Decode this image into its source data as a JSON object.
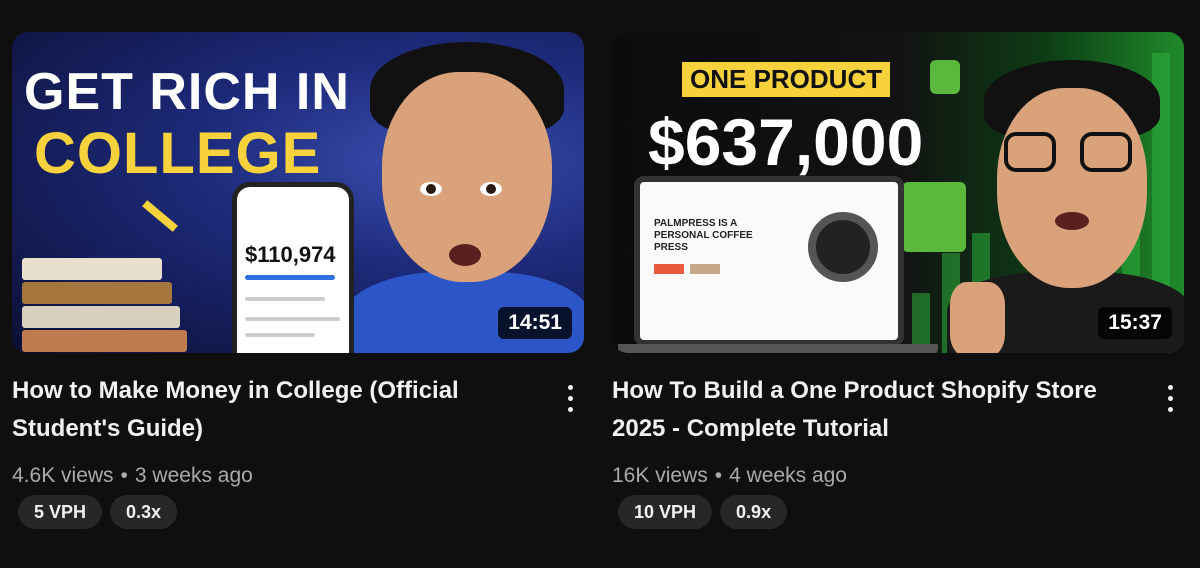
{
  "videos": [
    {
      "duration": "14:51",
      "title": "How to Make Money in College (Official Student's Guide)",
      "views": "4.6K views",
      "age": "3 weeks ago",
      "badges": [
        "5 VPH",
        "0.3x"
      ],
      "thumbnail": {
        "headline_1": "GET RICH IN",
        "headline_2": "COLLEGE",
        "phone_amount": "$110,974"
      }
    },
    {
      "duration": "15:37",
      "title": "How To Build a One Product Shopify Store 2025 - Complete Tutorial",
      "views": "16K views",
      "age": "4 weeks ago",
      "badges": [
        "10 VPH",
        "0.9x"
      ],
      "thumbnail": {
        "label": "ONE PRODUCT",
        "amount": "$637,000",
        "laptop_text": "PALMPRESS IS A PERSONAL COFFEE PRESS"
      }
    }
  ],
  "separator": "•",
  "colors": {
    "background": "#0f0f0f",
    "text_primary": "#f1f1f1",
    "text_secondary": "#aaaaaa",
    "pill_bg": "#272727",
    "accent_yellow": "#f7d23c",
    "shopify_green": "#5ab83c"
  }
}
